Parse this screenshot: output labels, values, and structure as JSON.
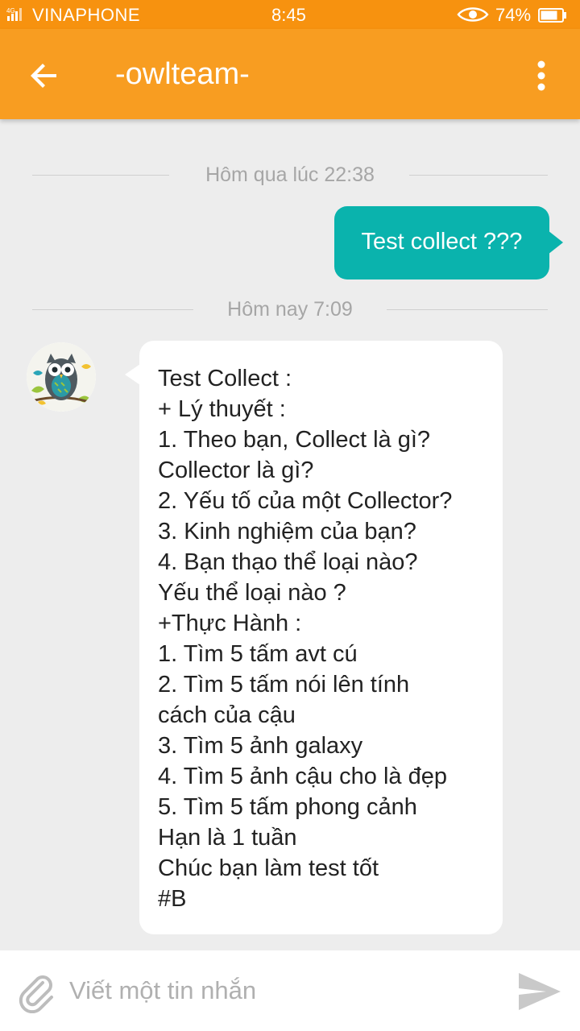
{
  "status_bar": {
    "signal": "4G",
    "carrier": "VINAPHONE",
    "time": "8:45",
    "battery": "74%",
    "icons": [
      "signal-icon",
      "eye-icon",
      "battery-icon"
    ]
  },
  "header": {
    "title": "-owlteam-",
    "back_icon": "arrow-left-icon",
    "menu_icon": "more-vert-icon",
    "color": "#f89d21"
  },
  "messages": {
    "separator_yesterday": "Hôm qua lúc 22:38",
    "outgoing": {
      "text": "Test collect ???",
      "color": "#0ab3ad"
    },
    "separator_today": "Hôm nay 7:09",
    "incoming": {
      "lines": [
        "Test Collect :",
        "+ Lý thuyết :",
        "1. Theo bạn, Collect là gì?",
        "Collector là gì?",
        "2. Yếu tố của một Collector?",
        "3. Kinh nghiệm của bạn?",
        "4. Bạn thạo thể loại nào?",
        "Yếu thể loại nào ?",
        "+Thực Hành :",
        "1. Tìm 5 tấm avt cú",
        "2. Tìm 5 tấm nói lên tính",
        "cách của cậu",
        "3. Tìm 5 ảnh galaxy",
        "4. Tìm 5 ảnh cậu cho là đẹp",
        "5. Tìm 5 tấm phong cảnh",
        "Hạn là 1 tuần",
        "Chúc bạn làm test tốt",
        "#B"
      ]
    }
  },
  "composer": {
    "placeholder": "Viết một tin nhắn",
    "value": "",
    "attach_icon": "paperclip-icon",
    "send_icon": "send-icon"
  }
}
